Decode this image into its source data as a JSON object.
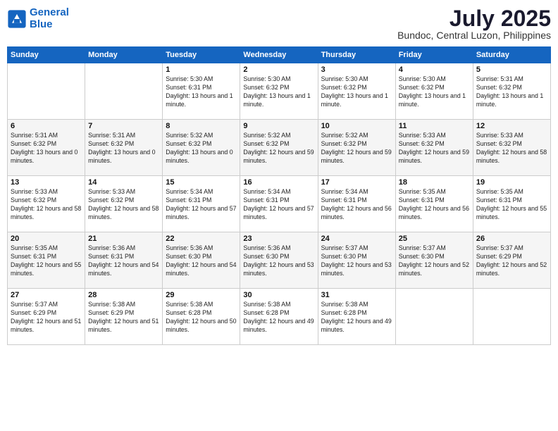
{
  "logo": {
    "line1": "General",
    "line2": "Blue"
  },
  "title": "July 2025",
  "location": "Bundoc, Central Luzon, Philippines",
  "days_of_week": [
    "Sunday",
    "Monday",
    "Tuesday",
    "Wednesday",
    "Thursday",
    "Friday",
    "Saturday"
  ],
  "weeks": [
    [
      {
        "day": "",
        "info": ""
      },
      {
        "day": "",
        "info": ""
      },
      {
        "day": "1",
        "info": "Sunrise: 5:30 AM\nSunset: 6:31 PM\nDaylight: 13 hours and 1 minute."
      },
      {
        "day": "2",
        "info": "Sunrise: 5:30 AM\nSunset: 6:32 PM\nDaylight: 13 hours and 1 minute."
      },
      {
        "day": "3",
        "info": "Sunrise: 5:30 AM\nSunset: 6:32 PM\nDaylight: 13 hours and 1 minute."
      },
      {
        "day": "4",
        "info": "Sunrise: 5:30 AM\nSunset: 6:32 PM\nDaylight: 13 hours and 1 minute."
      },
      {
        "day": "5",
        "info": "Sunrise: 5:31 AM\nSunset: 6:32 PM\nDaylight: 13 hours and 1 minute."
      }
    ],
    [
      {
        "day": "6",
        "info": "Sunrise: 5:31 AM\nSunset: 6:32 PM\nDaylight: 13 hours and 0 minutes."
      },
      {
        "day": "7",
        "info": "Sunrise: 5:31 AM\nSunset: 6:32 PM\nDaylight: 13 hours and 0 minutes."
      },
      {
        "day": "8",
        "info": "Sunrise: 5:32 AM\nSunset: 6:32 PM\nDaylight: 13 hours and 0 minutes."
      },
      {
        "day": "9",
        "info": "Sunrise: 5:32 AM\nSunset: 6:32 PM\nDaylight: 12 hours and 59 minutes."
      },
      {
        "day": "10",
        "info": "Sunrise: 5:32 AM\nSunset: 6:32 PM\nDaylight: 12 hours and 59 minutes."
      },
      {
        "day": "11",
        "info": "Sunrise: 5:33 AM\nSunset: 6:32 PM\nDaylight: 12 hours and 59 minutes."
      },
      {
        "day": "12",
        "info": "Sunrise: 5:33 AM\nSunset: 6:32 PM\nDaylight: 12 hours and 58 minutes."
      }
    ],
    [
      {
        "day": "13",
        "info": "Sunrise: 5:33 AM\nSunset: 6:32 PM\nDaylight: 12 hours and 58 minutes."
      },
      {
        "day": "14",
        "info": "Sunrise: 5:33 AM\nSunset: 6:32 PM\nDaylight: 12 hours and 58 minutes."
      },
      {
        "day": "15",
        "info": "Sunrise: 5:34 AM\nSunset: 6:31 PM\nDaylight: 12 hours and 57 minutes."
      },
      {
        "day": "16",
        "info": "Sunrise: 5:34 AM\nSunset: 6:31 PM\nDaylight: 12 hours and 57 minutes."
      },
      {
        "day": "17",
        "info": "Sunrise: 5:34 AM\nSunset: 6:31 PM\nDaylight: 12 hours and 56 minutes."
      },
      {
        "day": "18",
        "info": "Sunrise: 5:35 AM\nSunset: 6:31 PM\nDaylight: 12 hours and 56 minutes."
      },
      {
        "day": "19",
        "info": "Sunrise: 5:35 AM\nSunset: 6:31 PM\nDaylight: 12 hours and 55 minutes."
      }
    ],
    [
      {
        "day": "20",
        "info": "Sunrise: 5:35 AM\nSunset: 6:31 PM\nDaylight: 12 hours and 55 minutes."
      },
      {
        "day": "21",
        "info": "Sunrise: 5:36 AM\nSunset: 6:31 PM\nDaylight: 12 hours and 54 minutes."
      },
      {
        "day": "22",
        "info": "Sunrise: 5:36 AM\nSunset: 6:30 PM\nDaylight: 12 hours and 54 minutes."
      },
      {
        "day": "23",
        "info": "Sunrise: 5:36 AM\nSunset: 6:30 PM\nDaylight: 12 hours and 53 minutes."
      },
      {
        "day": "24",
        "info": "Sunrise: 5:37 AM\nSunset: 6:30 PM\nDaylight: 12 hours and 53 minutes."
      },
      {
        "day": "25",
        "info": "Sunrise: 5:37 AM\nSunset: 6:30 PM\nDaylight: 12 hours and 52 minutes."
      },
      {
        "day": "26",
        "info": "Sunrise: 5:37 AM\nSunset: 6:29 PM\nDaylight: 12 hours and 52 minutes."
      }
    ],
    [
      {
        "day": "27",
        "info": "Sunrise: 5:37 AM\nSunset: 6:29 PM\nDaylight: 12 hours and 51 minutes."
      },
      {
        "day": "28",
        "info": "Sunrise: 5:38 AM\nSunset: 6:29 PM\nDaylight: 12 hours and 51 minutes."
      },
      {
        "day": "29",
        "info": "Sunrise: 5:38 AM\nSunset: 6:28 PM\nDaylight: 12 hours and 50 minutes."
      },
      {
        "day": "30",
        "info": "Sunrise: 5:38 AM\nSunset: 6:28 PM\nDaylight: 12 hours and 49 minutes."
      },
      {
        "day": "31",
        "info": "Sunrise: 5:38 AM\nSunset: 6:28 PM\nDaylight: 12 hours and 49 minutes."
      },
      {
        "day": "",
        "info": ""
      },
      {
        "day": "",
        "info": ""
      }
    ]
  ]
}
